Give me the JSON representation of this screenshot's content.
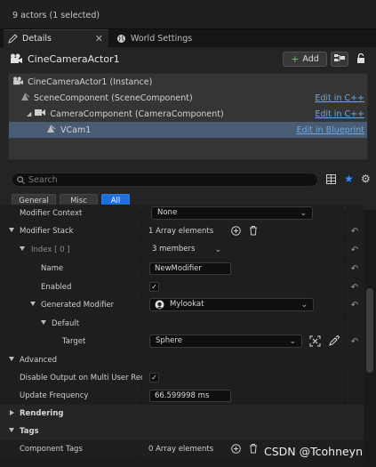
{
  "status_bar": {
    "text": "9 actors (1 selected)"
  },
  "tabs": [
    {
      "label": "Details",
      "icon": "pencil-icon",
      "active": true
    },
    {
      "label": "World Settings",
      "icon": "globe-icon",
      "active": false
    }
  ],
  "actor": {
    "name": "CineCameraActor1",
    "add_label": "Add"
  },
  "components": [
    {
      "label": "CineCameraActor1 (Instance)",
      "link": ""
    },
    {
      "label": "SceneComponent (SceneComponent)",
      "link": "Edit in C++"
    },
    {
      "label": "CameraComponent (CameraComponent)",
      "link": "Edit in C++"
    },
    {
      "label": "VCam1",
      "link": "Edit in Blueprint",
      "selected": true
    }
  ],
  "search": {
    "placeholder": "Search"
  },
  "filters": [
    {
      "label": "General",
      "active": false
    },
    {
      "label": "Misc",
      "active": false
    },
    {
      "label": "All",
      "active": true
    }
  ],
  "properties": {
    "modifier_context": {
      "label": "Modifier Context",
      "value": "None"
    },
    "modifier_stack": {
      "label": "Modifier Stack",
      "value": "1 Array elements"
    },
    "index": {
      "label": "Index [ 0 ]",
      "value": "3 members"
    },
    "name": {
      "label": "Name",
      "value": "NewModifier"
    },
    "enabled": {
      "label": "Enabled",
      "checked": true
    },
    "generated_modifier": {
      "label": "Generated Modifier",
      "value": "Mylookat"
    },
    "default": {
      "label": "Default"
    },
    "target": {
      "label": "Target",
      "value": "Sphere"
    },
    "advanced": {
      "label": "Advanced"
    },
    "disable_output": {
      "label": "Disable Output on Multi User Rece...",
      "checked": true
    },
    "update_frequency": {
      "label": "Update Frequency",
      "value": "66.599998 ms"
    },
    "rendering": {
      "label": "Rendering"
    },
    "tags": {
      "label": "Tags"
    },
    "component_tags": {
      "label": "Component Tags",
      "value": "0 Array elements"
    }
  },
  "watermark": "CSDN @Tcohneyn",
  "colors": {
    "accent": "#1e6fd9",
    "selected_row": "#4a5c73",
    "link": "#6fa8dc"
  }
}
